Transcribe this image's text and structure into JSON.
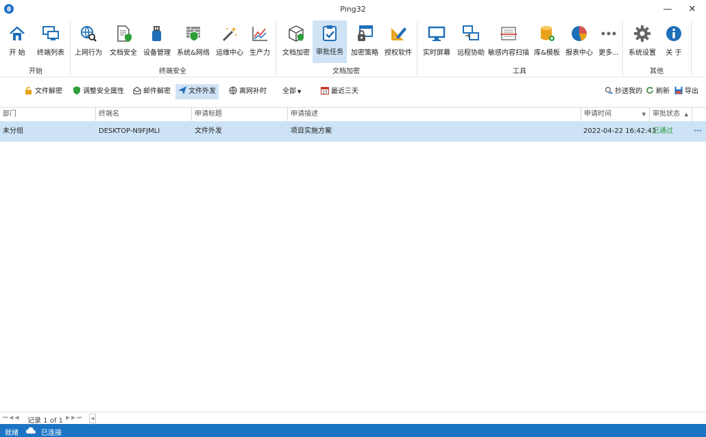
{
  "window": {
    "title": "Ping32"
  },
  "ribbon": {
    "buttons": [
      {
        "label": "开 始",
        "icon": "home-icon"
      },
      {
        "label": "终端列表",
        "icon": "monitors-icon"
      },
      {
        "label": "上网行为",
        "icon": "globe-search-icon"
      },
      {
        "label": "文档安全",
        "icon": "document-shield-icon"
      },
      {
        "label": "设备管理",
        "icon": "usb-device-icon"
      },
      {
        "label": "系统&网络",
        "icon": "firewall-shield-icon"
      },
      {
        "label": "运维中心",
        "icon": "magic-wand-icon"
      },
      {
        "label": "生产力",
        "icon": "line-chart-icon"
      },
      {
        "label": "文档加密",
        "icon": "box-shield-icon"
      },
      {
        "label": "审批任务",
        "icon": "clipboard-check-icon"
      },
      {
        "label": "加密策略",
        "icon": "window-lock-icon"
      },
      {
        "label": "授权软件",
        "icon": "ruler-pencil-icon"
      },
      {
        "label": "实时屏幕",
        "icon": "screen-icon"
      },
      {
        "label": "远程协助",
        "icon": "remote-desktop-icon"
      },
      {
        "label": "敏感内容扫描",
        "icon": "scan-icon"
      },
      {
        "label": "库&模板",
        "icon": "database-icon"
      },
      {
        "label": "报表中心",
        "icon": "pie-chart-icon"
      },
      {
        "label": "更多...",
        "icon": "more-dots-icon"
      },
      {
        "label": "系统设置",
        "icon": "gear-icon"
      },
      {
        "label": "关 于",
        "icon": "info-icon"
      }
    ],
    "groups": [
      "开始",
      "终端安全",
      "文档加密",
      "工具",
      "其他"
    ]
  },
  "toolbar": {
    "items": [
      "文件解密",
      "调整安全属性",
      "邮件解密",
      "文件外发",
      "离网补时"
    ],
    "filter": "全部",
    "date_range": "最近三天",
    "cc_me": "抄送我的",
    "refresh": "刷新",
    "export": "导出"
  },
  "grid": {
    "columns": [
      "部门",
      "终端名",
      "申请标题",
      "申请描述",
      "申请时间",
      "审批状态"
    ],
    "rows": [
      {
        "dept": "未分组",
        "terminal": "DESKTOP-N9FJMLI",
        "title": "文件外发",
        "desc": "项目实施方案",
        "time": "2022-04-22 16:42:43",
        "status": "已通过",
        "more": "···"
      }
    ]
  },
  "pager": {
    "record": "记录 1 of 1"
  },
  "status": {
    "ready": "就绪",
    "connection": "已连接"
  },
  "colors": {
    "accent": "#1b73c4",
    "selected_row": "#cde3f5",
    "approved": "#2e9e3a"
  }
}
